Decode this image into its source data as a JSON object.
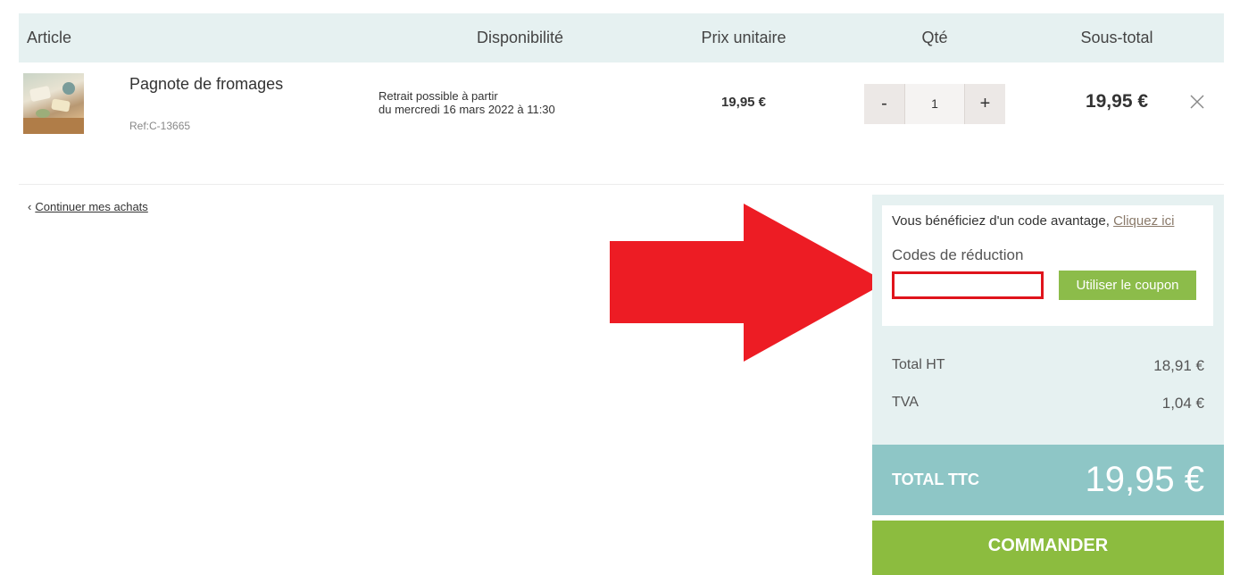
{
  "table": {
    "headers": {
      "article": "Article",
      "disponibilite": "Disponibilité",
      "prix_unitaire": "Prix unitaire",
      "qte": "Qté",
      "sous_total": "Sous-total"
    }
  },
  "product": {
    "name": "Pagnote de fromages",
    "ref": "Ref:C-13665",
    "availability_line1": "Retrait possible à partir",
    "availability_line2": "du mercredi 16 mars 2022 à 11:30",
    "unit_price": "19,95 €",
    "qty_minus": "-",
    "qty_value": "1",
    "qty_plus": "+",
    "subtotal": "19,95 €",
    "remove_icon": "close-icon",
    "thumbnail_icon": "cheese-platter-image"
  },
  "continue_shopping": {
    "chevron": "‹",
    "label": "Continuer mes achats"
  },
  "coupon": {
    "advantage_text": "Vous bénéficiez d'un code avantage,",
    "advantage_link": "Cliquez ici",
    "codes_label": "Codes de réduction",
    "input_value": "",
    "input_placeholder": "",
    "button_label": "Utiliser le coupon"
  },
  "totals": {
    "total_ht_label": "Total HT",
    "total_ht_value": "18,91 €",
    "tva_label": "TVA",
    "tva_value": "1,04 €",
    "total_ttc_label": "TOTAL TTC",
    "total_ttc_value": "19,95 €"
  },
  "checkout": {
    "label": "COMMANDER"
  },
  "colors": {
    "header_bg": "#e6f1f1",
    "accent_green": "#8cbc3f",
    "total_ttc_bg": "#8ec6c6",
    "highlight_red": "#e0141c",
    "arrow_red": "#ed1c24"
  }
}
